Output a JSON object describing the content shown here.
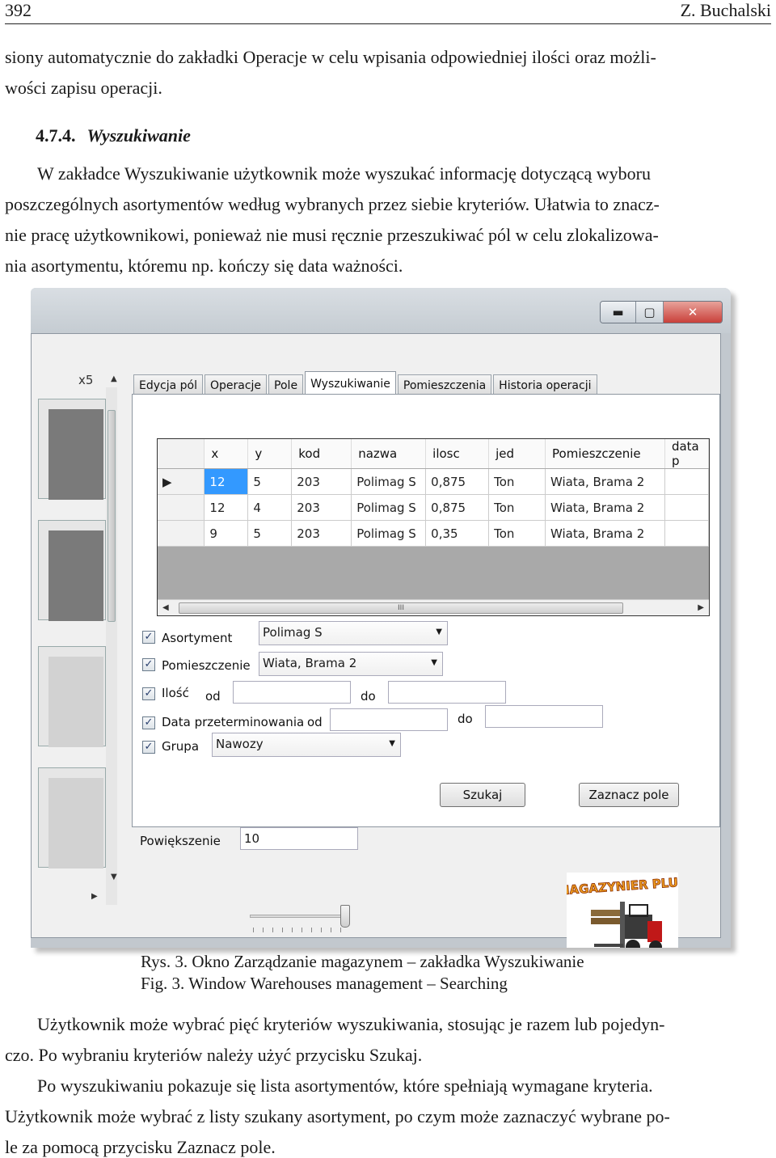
{
  "header": {
    "page_number": "392",
    "author": "Z. Buchalski"
  },
  "para1": [
    "siony automatycznie do zakładki Operacje w celu wpisania odpowiedniej ilości oraz możli-",
    "wości zapisu operacji."
  ],
  "section": {
    "number": "4.7.4.",
    "title": "Wyszukiwanie"
  },
  "para2": [
    "W zakładce Wyszukiwanie użytkownik może wyszukać informację dotyczącą wyboru",
    "poszczególnych asortymentów według wybranych przez siebie kryteriów. Ułatwia to znacz-",
    "nie pracę użytkownikowi, ponieważ nie musi ręcznie przeszukiwać pól w celu zlokalizowa-",
    "nia asortymentu, któremu np. kończy się data ważności."
  ],
  "window": {
    "buttons": {
      "minimize": "▬",
      "maximize": "▢",
      "close": "✕"
    },
    "x5": "x5",
    "tabs": [
      "Edycja pól",
      "Operacje",
      "Pole",
      "Wyszukiwanie",
      "Pomieszczenia",
      "Historia operacji"
    ],
    "grid": {
      "columns": [
        "x",
        "y",
        "kod",
        "nazwa",
        "ilosc",
        "jed",
        "Pomieszczenie",
        "data p"
      ],
      "rows": [
        [
          "12",
          "5",
          "203",
          "Polimag S",
          "0,875",
          "Ton",
          "Wiata, Brama 2",
          ""
        ],
        [
          "12",
          "4",
          "203",
          "Polimag S",
          "0,875",
          "Ton",
          "Wiata, Brama 2",
          ""
        ],
        [
          "9",
          "5",
          "203",
          "Polimag S",
          "0,35",
          "Ton",
          "Wiata, Brama 2",
          ""
        ]
      ],
      "current_row_marker": "▶",
      "scroll_grip": "III"
    },
    "filters": {
      "asortyment_label": "Asortyment",
      "asortyment_value": "Polimag S",
      "pomieszczenie_label": "Pomieszczenie",
      "pomieszczenie_value": "Wiata, Brama 2",
      "ilosc_label": "Ilość",
      "od": "od",
      "do": "do",
      "data_label": "Data przeterminowania",
      "grupa_label": "Grupa",
      "grupa_value": "Nawozy",
      "check": "✓"
    },
    "buttons_row": {
      "szukaj": "Szukaj",
      "zaznacz": "Zaznacz pole"
    },
    "zoom": {
      "label": "Powiększenie",
      "value": "10",
      "slider_fraction": 0.9
    },
    "logo_text": "MAGAZYNIER PLUS"
  },
  "caption": {
    "pl": "Rys. 3. Okno Zarządzanie magazynem – zakładka Wyszukiwanie",
    "en": "Fig. 3.  Window Warehouses management – Searching"
  },
  "para3": [
    "Użytkownik może wybrać pięć kryteriów wyszukiwania, stosując je razem lub pojedyn-",
    "czo. Po wybraniu kryteriów należy użyć przycisku Szukaj."
  ],
  "para4": [
    "Po wyszukiwaniu pokazuje się lista asortymentów, które spełniają wymagane kryteria.",
    "Użytkownik może wybrać z listy szukany asortyment, po czym może zaznaczyć wybrane po-",
    "le za pomocą przycisku Zaznacz pole."
  ]
}
